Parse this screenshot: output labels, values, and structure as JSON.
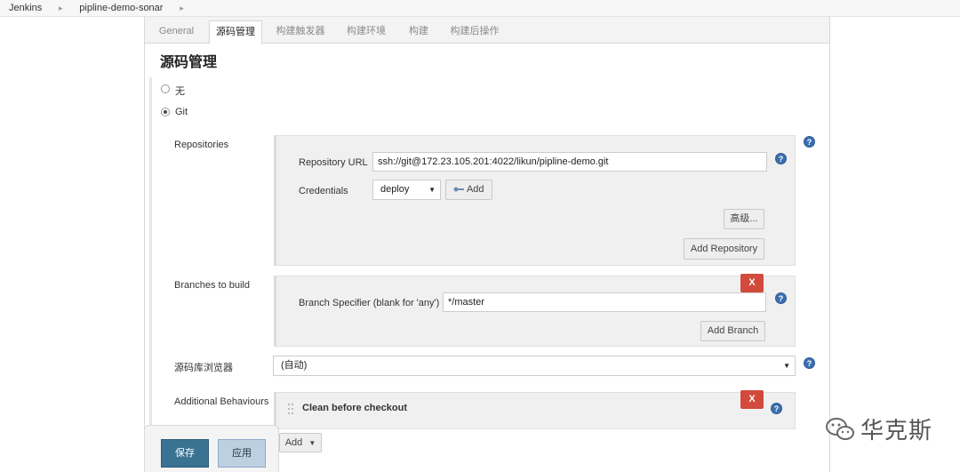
{
  "breadcrumb": {
    "items": [
      "Jenkins",
      "pipline-demo-sonar"
    ],
    "sep": "▸"
  },
  "tabs": [
    "General",
    "源码管理",
    "构建触发器",
    "构建环境",
    "构建",
    "构建后操作"
  ],
  "section": {
    "title": "源码管理"
  },
  "scm": {
    "options": [
      "无",
      "Git"
    ]
  },
  "repositories": {
    "label": "Repositories",
    "url_label": "Repository URL",
    "url_value": "ssh://git@172.23.105.201:4022/likun/pipline-demo.git",
    "cred_label": "Credentials",
    "cred_value": "deploy",
    "add_cred": "Add",
    "advanced": "高级...",
    "add_repo": "Add Repository"
  },
  "branches": {
    "label": "Branches to build",
    "spec_label": "Branch Specifier (blank for 'any')",
    "spec_value": "*/master",
    "delete": "X",
    "add_branch": "Add Branch"
  },
  "browser": {
    "label": "源码库浏览器",
    "value": "(自动)"
  },
  "behaviours": {
    "label": "Additional Behaviours",
    "item": "Clean before checkout",
    "delete": "X",
    "add": "Add"
  },
  "footer": {
    "save": "保存",
    "apply": "应用"
  },
  "help": "?",
  "watermark": {
    "text": "华克斯"
  }
}
